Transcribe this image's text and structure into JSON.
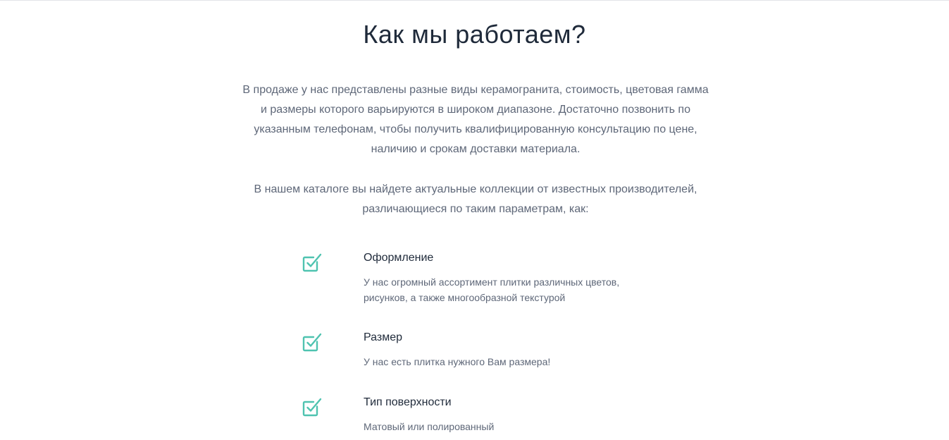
{
  "section": {
    "title": "Как мы работаем?",
    "intro_1": "В продаже у нас представлены разные виды керамогранита, стоимость, цветовая гамма и размеры которого варьируются в широком диапазоне. Достаточно позвонить по указанным телефонам, чтобы получить квалифицированную консультацию по цене, наличию и срокам доставки материала.",
    "intro_2": "В нашем каталоге вы найдете актуальные коллекции от известных производителей, различающиеся по таким параметрам, как:"
  },
  "features": [
    {
      "icon": "checkbox-checked-icon",
      "title": "Оформление",
      "description": "У нас огромный ассортимент плитки различных цветов, рисунков, а также многообразной текстурой"
    },
    {
      "icon": "checkbox-checked-icon",
      "title": "Размер",
      "description": "У нас есть плитка нужного Вам размера!"
    },
    {
      "icon": "checkbox-checked-icon",
      "title": "Тип поверхности",
      "description": "Матовый или полированный"
    }
  ],
  "colors": {
    "heading": "#1f2a3a",
    "body_text": "#5e6778",
    "accent": "#4fc3b0"
  }
}
